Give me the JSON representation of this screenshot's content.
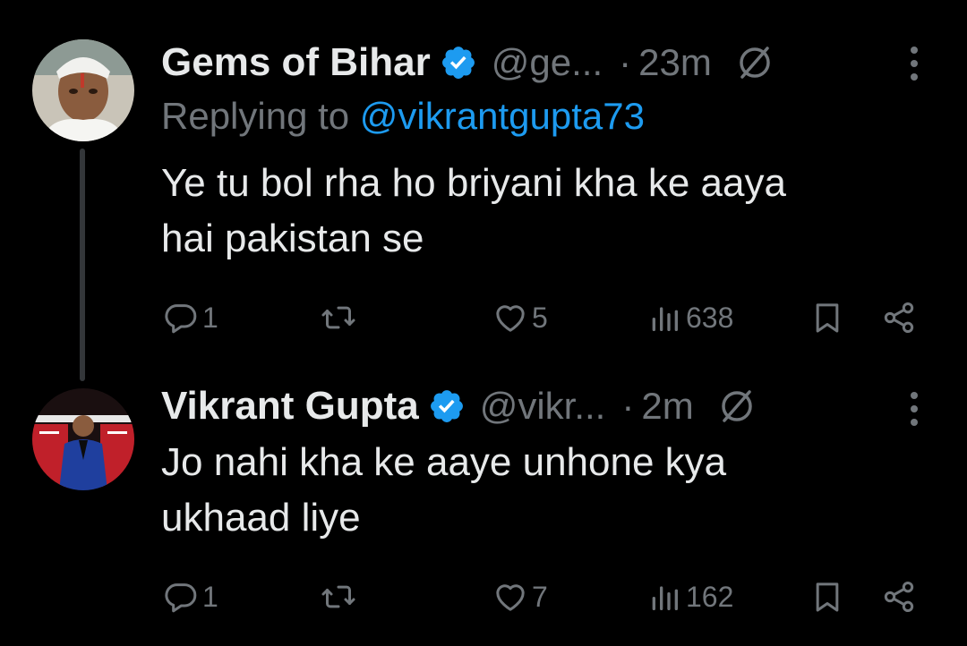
{
  "tweets": [
    {
      "name": "Gems of Bihar",
      "handle": "@ge...",
      "dot": "·",
      "time": "23m",
      "replying_label": "Replying to ",
      "replying_handle": "@vikrantgupta73",
      "text_line1": "Ye tu bol rha ho briyani kha ke aaya",
      "text_line2": "hai pakistan se",
      "replies": "1",
      "likes": "5",
      "views": "638"
    },
    {
      "name": "Vikrant Gupta",
      "handle": "@vikr...",
      "dot": "·",
      "time": "2m",
      "text_line1": "Jo nahi kha ke aaye unhone kya",
      "text_line2": "ukhaad liye",
      "replies": "1",
      "likes": "7",
      "views": "162"
    }
  ],
  "colors": {
    "background": "#000000",
    "text": "#e7e9ea",
    "muted": "#71767b",
    "accent": "#1d9bf0"
  },
  "icons": [
    "verified-badge-icon",
    "grok-icon",
    "more-icon",
    "reply-icon",
    "retweet-icon",
    "like-icon",
    "views-icon",
    "bookmark-icon",
    "share-icon"
  ]
}
